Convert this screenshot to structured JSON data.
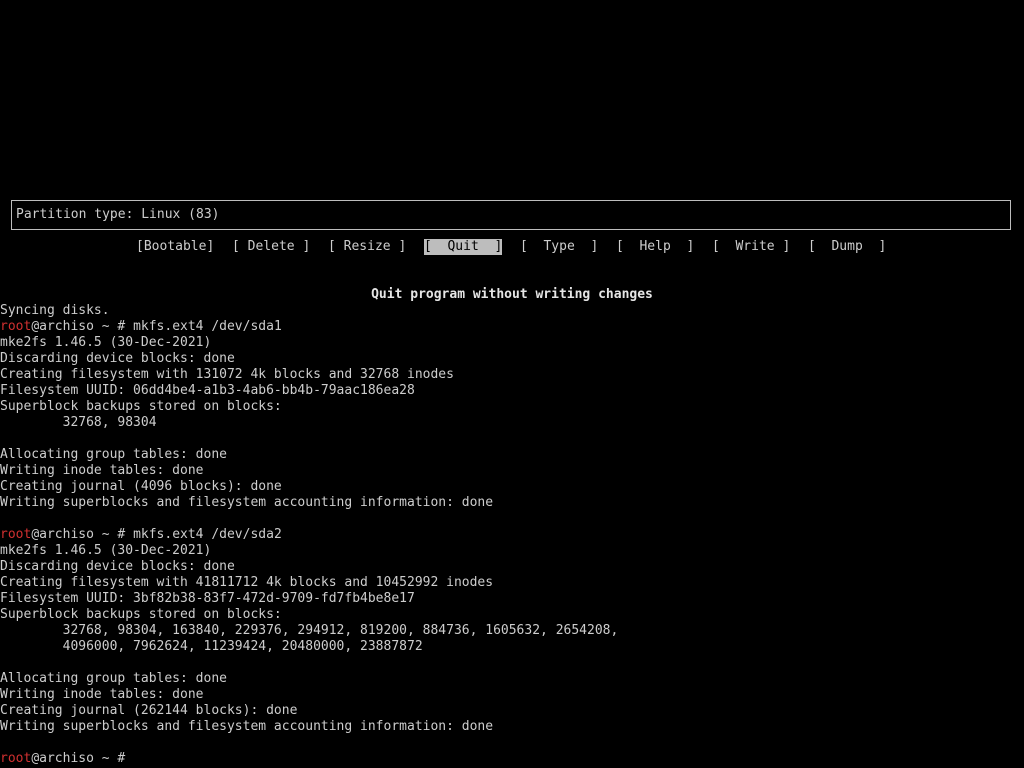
{
  "partition_info": {
    "type_text": "Partition type: Linux (83)"
  },
  "menu": {
    "items": [
      {
        "label": "[Bootable]"
      },
      {
        "label": "[ Delete ]"
      },
      {
        "label": "[ Resize ]"
      },
      {
        "label": "[  Quit  ]",
        "selected": true
      },
      {
        "label": "[  Type  ]"
      },
      {
        "label": "[  Help  ]"
      },
      {
        "label": "[  Write ]"
      },
      {
        "label": "[  Dump  ]"
      }
    ]
  },
  "status_message": "Quit program without writing changes",
  "prompt": {
    "user": "root",
    "rest": "@archiso ~ # "
  },
  "terminal": {
    "l0": "Syncing disks.",
    "cmd1": "mkfs.ext4 /dev/sda1",
    "l2": "mke2fs 1.46.5 (30-Dec-2021)",
    "l3": "Discarding device blocks: done",
    "l4": "Creating filesystem with 131072 4k blocks and 32768 inodes",
    "l5": "Filesystem UUID: 06dd4be4-a1b3-4ab6-bb4b-79aac186ea28",
    "l6": "Superblock backups stored on blocks:",
    "l7": "        32768, 98304",
    "l9": "Allocating group tables: done",
    "l10": "Writing inode tables: done",
    "l11": "Creating journal (4096 blocks): done",
    "l12": "Writing superblocks and filesystem accounting information: done",
    "cmd2": "mkfs.ext4 /dev/sda2",
    "l15": "mke2fs 1.46.5 (30-Dec-2021)",
    "l16": "Discarding device blocks: done",
    "l17": "Creating filesystem with 41811712 4k blocks and 10452992 inodes",
    "l18": "Filesystem UUID: 3bf82b38-83f7-472d-9709-fd7fb4be8e17",
    "l19": "Superblock backups stored on blocks:",
    "l20": "        32768, 98304, 163840, 229376, 294912, 819200, 884736, 1605632, 2654208,",
    "l21": "        4096000, 7962624, 11239424, 20480000, 23887872",
    "l23": "Allocating group tables: done",
    "l24": "Writing inode tables: done",
    "l25": "Creating journal (262144 blocks): done",
    "l26": "Writing superblocks and filesystem accounting information: done"
  },
  "colors": {
    "background": "#000000",
    "foreground": "#cdcdcd",
    "root_user": "#d03030",
    "selection_bg": "#bdbdbd"
  }
}
